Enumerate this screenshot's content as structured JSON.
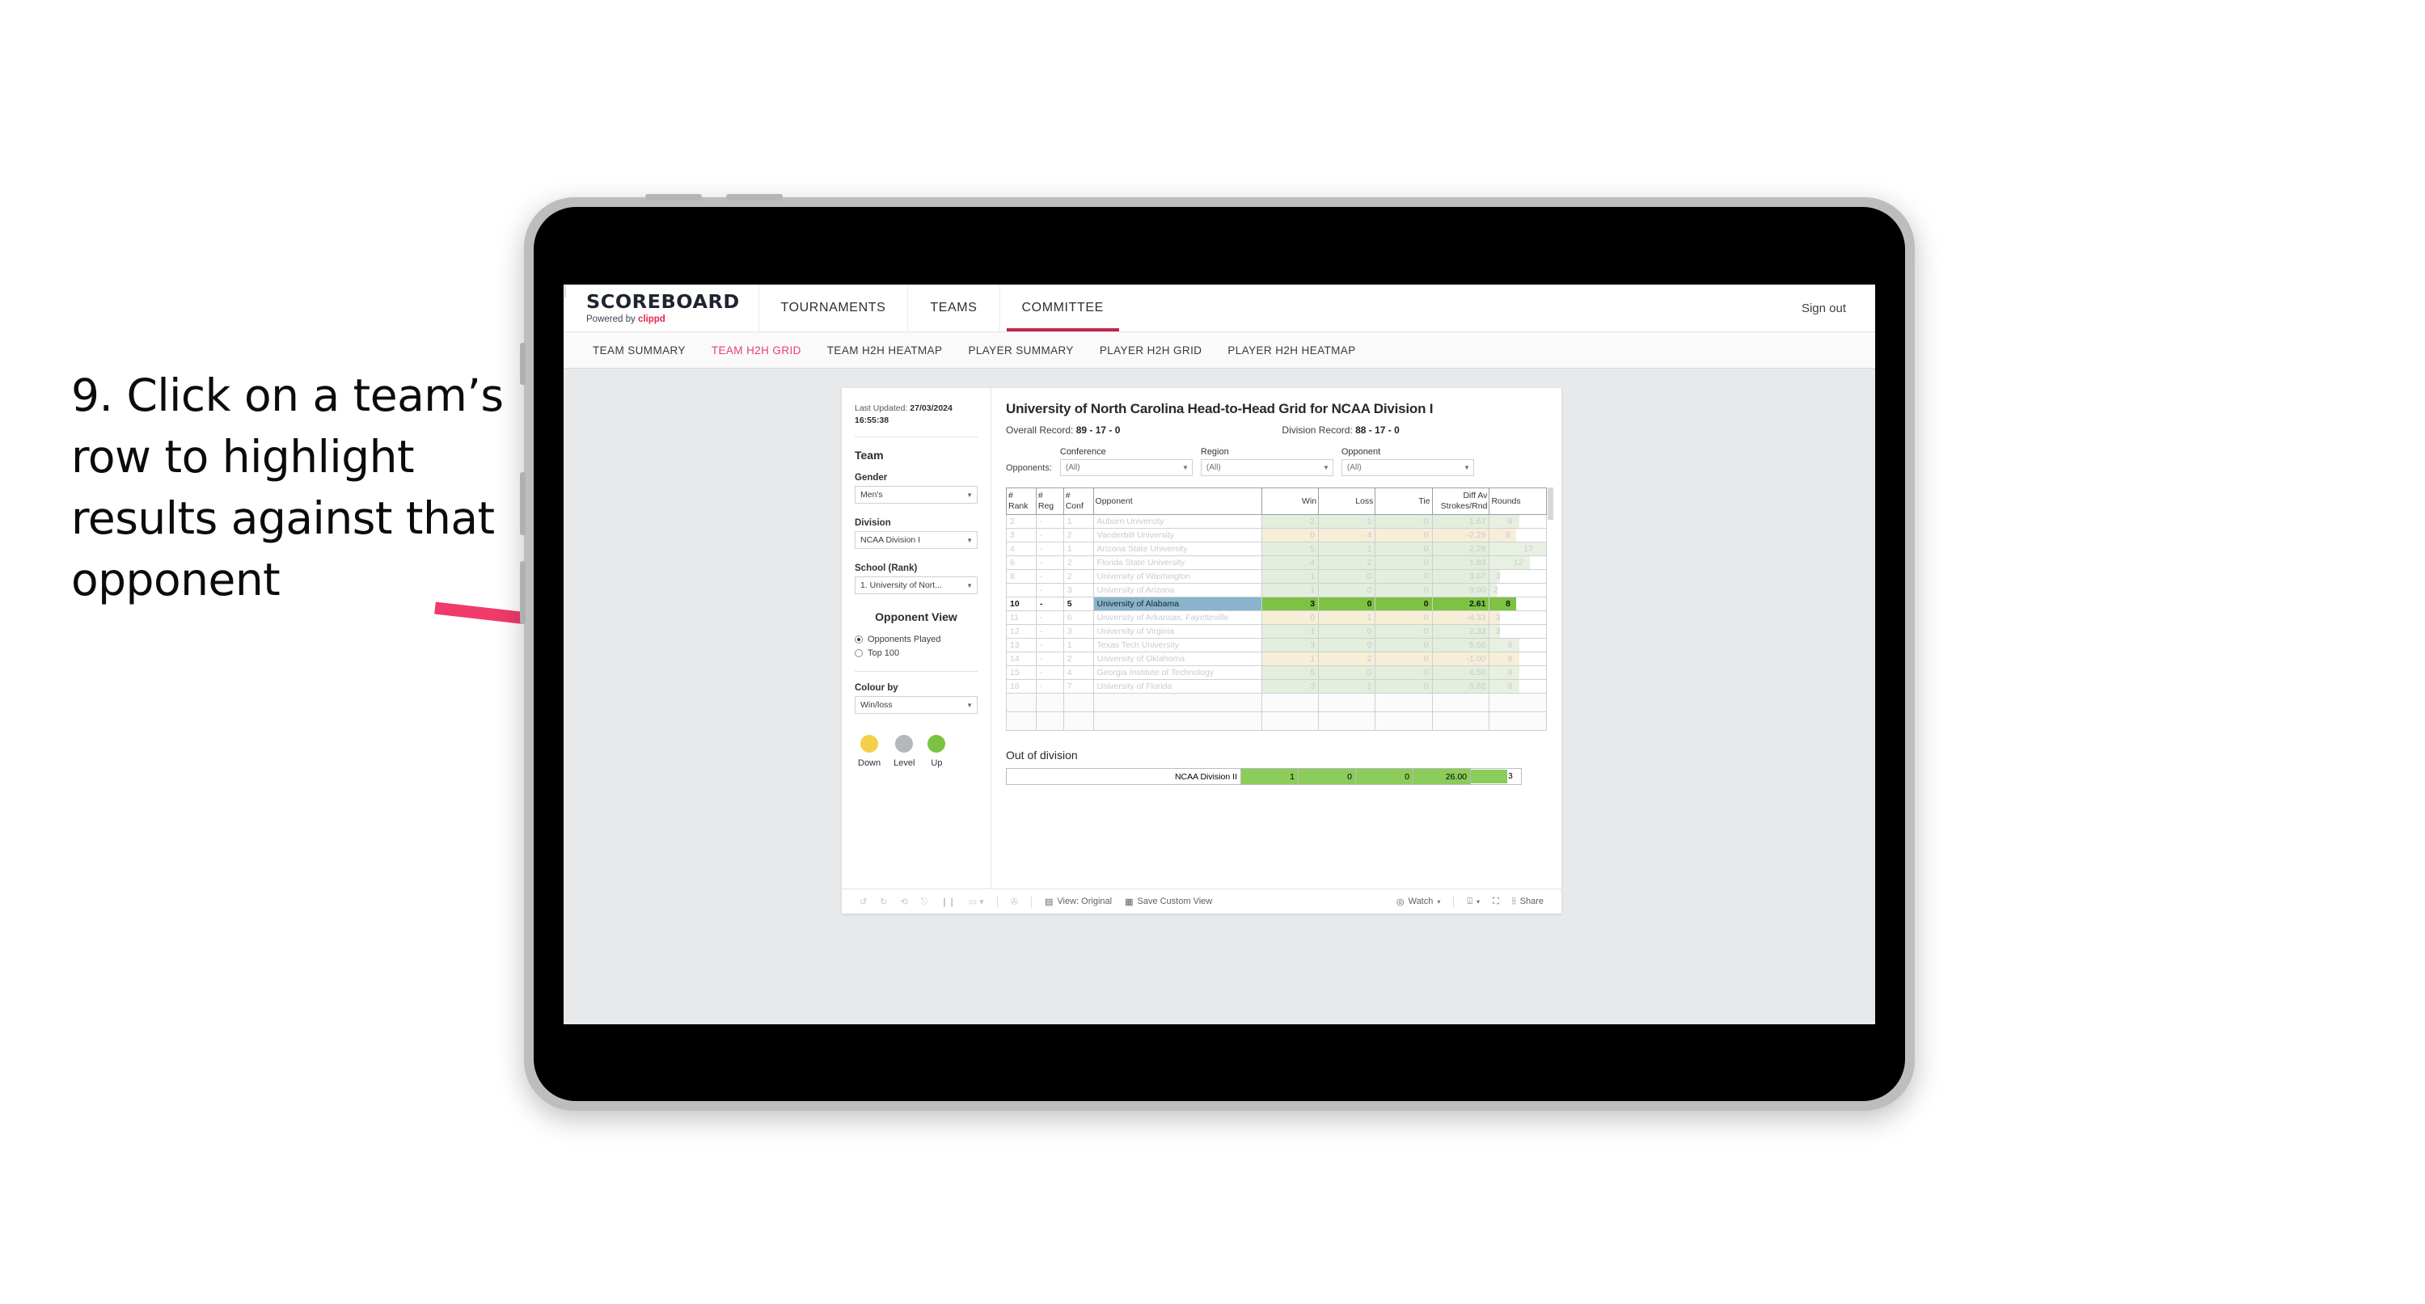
{
  "annotation": {
    "text": "9. Click on a team’s row to highlight results against that opponent",
    "arrow_color": "#ef3a6a"
  },
  "app": {
    "brand_name": "SCOREBOARD",
    "brand_sub_prefix": "Powered by ",
    "brand_sub_name": "clippd",
    "accent_color": "#e8254f",
    "main_nav": [
      {
        "label": "TOURNAMENTS",
        "active": false
      },
      {
        "label": "TEAMS",
        "active": false
      },
      {
        "label": "COMMITTEE",
        "active": true
      }
    ],
    "signout_divider": "|",
    "signout_label": "Sign out",
    "sub_nav": [
      {
        "label": "TEAM SUMMARY",
        "active": false
      },
      {
        "label": "TEAM H2H GRID",
        "active": true
      },
      {
        "label": "TEAM H2H HEATMAP",
        "active": false
      },
      {
        "label": "PLAYER SUMMARY",
        "active": false
      },
      {
        "label": "PLAYER H2H GRID",
        "active": false
      },
      {
        "label": "PLAYER H2H HEATMAP",
        "active": false
      }
    ]
  },
  "filters": {
    "last_updated_label": "Last Updated: ",
    "last_updated_date": "27/03/2024",
    "last_updated_time": "16:55:38",
    "team_heading": "Team",
    "gender_label": "Gender",
    "gender_value": "Men's",
    "division_label": "Division",
    "division_value": "NCAA Division I",
    "school_label": "School (Rank)",
    "school_value": "1. University of Nort...",
    "opponent_view_heading": "Opponent View",
    "opponent_view_options": [
      {
        "label": "Opponents Played",
        "selected": true
      },
      {
        "label": "Top 100",
        "selected": false
      }
    ],
    "colour_by_label": "Colour by",
    "colour_by_value": "Win/loss",
    "legend": [
      {
        "label": "Down",
        "color": "#f2d048"
      },
      {
        "label": "Level",
        "color": "#b5b7ba"
      },
      {
        "label": "Up",
        "color": "#7cc242"
      }
    ]
  },
  "viz": {
    "title": "University of North Carolina Head-to-Head Grid for NCAA Division I",
    "overall_record_label": "Overall Record: ",
    "overall_record_value": "89 - 17 - 0",
    "division_record_label": "Division Record: ",
    "division_record_value": "88 - 17 - 0",
    "opponents_label": "Opponents:",
    "opponent_filters": [
      {
        "name": "Conference",
        "value": "(All)"
      },
      {
        "name": "Region",
        "value": "(All)"
      },
      {
        "name": "Opponent",
        "value": "(All)"
      }
    ],
    "columns": [
      {
        "l1": "#",
        "l2": "Rank"
      },
      {
        "l1": "#",
        "l2": "Reg"
      },
      {
        "l1": "#",
        "l2": "Conf"
      },
      {
        "l1": "",
        "l2": "Opponent"
      },
      {
        "l1": "Win",
        "l2": ""
      },
      {
        "l1": "Loss",
        "l2": ""
      },
      {
        "l1": "Tie",
        "l2": ""
      },
      {
        "l1": "Diff Av",
        "l2": "Strokes/Rnd"
      },
      {
        "l1": "Rounds",
        "l2": ""
      }
    ],
    "rows": [
      {
        "rank": "2",
        "reg": "-",
        "conf": "1",
        "opponent": "Auburn University",
        "win": "2",
        "loss": "1",
        "tie": "0",
        "diff": "1.67",
        "rounds": "9",
        "tone": "up",
        "selected": false
      },
      {
        "rank": "3",
        "reg": "-",
        "conf": "2",
        "opponent": "Vanderbilt University",
        "win": "0",
        "loss": "4",
        "tie": "0",
        "diff": "-2.29",
        "rounds": "8",
        "tone": "down",
        "selected": false
      },
      {
        "rank": "4",
        "reg": "-",
        "conf": "1",
        "opponent": "Arizona State University",
        "win": "5",
        "loss": "1",
        "tie": "0",
        "diff": "2.28",
        "rounds": "17",
        "tone": "up",
        "selected": false
      },
      {
        "rank": "6",
        "reg": "-",
        "conf": "2",
        "opponent": "Florida State University",
        "win": "4",
        "loss": "2",
        "tie": "0",
        "diff": "1.83",
        "rounds": "12",
        "tone": "up",
        "selected": false
      },
      {
        "rank": "8",
        "reg": "-",
        "conf": "2",
        "opponent": "University of Washington",
        "win": "1",
        "loss": "0",
        "tie": "0",
        "diff": "3.67",
        "rounds": "3",
        "tone": "up",
        "selected": false
      },
      {
        "rank": "",
        "reg": "-",
        "conf": "3",
        "opponent": "University of Arizona",
        "win": "1",
        "loss": "0",
        "tie": "0",
        "diff": "9.00",
        "rounds": "2",
        "tone": "up",
        "selected": false
      },
      {
        "rank": "10",
        "reg": "-",
        "conf": "5",
        "opponent": "University of Alabama",
        "win": "3",
        "loss": "0",
        "tie": "0",
        "diff": "2.61",
        "rounds": "8",
        "tone": "up",
        "selected": true
      },
      {
        "rank": "11",
        "reg": "-",
        "conf": "6",
        "opponent": "University of Arkansas, Fayetteville",
        "win": "0",
        "loss": "1",
        "tie": "0",
        "diff": "-4.33",
        "rounds": "3",
        "tone": "down",
        "selected": false
      },
      {
        "rank": "12",
        "reg": "-",
        "conf": "3",
        "opponent": "University of Virginia",
        "win": "1",
        "loss": "0",
        "tie": "0",
        "diff": "2.33",
        "rounds": "3",
        "tone": "up",
        "selected": false
      },
      {
        "rank": "13",
        "reg": "-",
        "conf": "1",
        "opponent": "Texas Tech University",
        "win": "3",
        "loss": "0",
        "tie": "0",
        "diff": "5.56",
        "rounds": "9",
        "tone": "up",
        "selected": false
      },
      {
        "rank": "14",
        "reg": "-",
        "conf": "2",
        "opponent": "University of Oklahoma",
        "win": "1",
        "loss": "2",
        "tie": "0",
        "diff": "-1.00",
        "rounds": "9",
        "tone": "down",
        "selected": false
      },
      {
        "rank": "15",
        "reg": "-",
        "conf": "4",
        "opponent": "Georgia Institute of Technology",
        "win": "5",
        "loss": "0",
        "tie": "0",
        "diff": "4.50",
        "rounds": "9",
        "tone": "up",
        "selected": false
      },
      {
        "rank": "16",
        "reg": "-",
        "conf": "7",
        "opponent": "University of Florida",
        "win": "3",
        "loss": "1",
        "tie": "0",
        "diff": "6.62",
        "rounds": "9",
        "tone": "up",
        "selected": false
      }
    ],
    "out_of_division_title": "Out of division",
    "out_of_division_row": {
      "label": "NCAA Division II",
      "win": "1",
      "loss": "0",
      "tie": "0",
      "diff": "26.00",
      "rounds": "3"
    },
    "toolbar": {
      "view_label": "View: Original",
      "save_label": "Save Custom View",
      "watch_label": "Watch",
      "share_label": "Share"
    },
    "colors": {
      "highlight_row": "#7dc242",
      "highlight_name": "#8ab4cc",
      "dim_up": "#e3eedd",
      "dim_down": "#f7eed8",
      "rounds_bar_up": "#e8f0e2",
      "rounds_bar_down": "#f7eed8"
    }
  }
}
